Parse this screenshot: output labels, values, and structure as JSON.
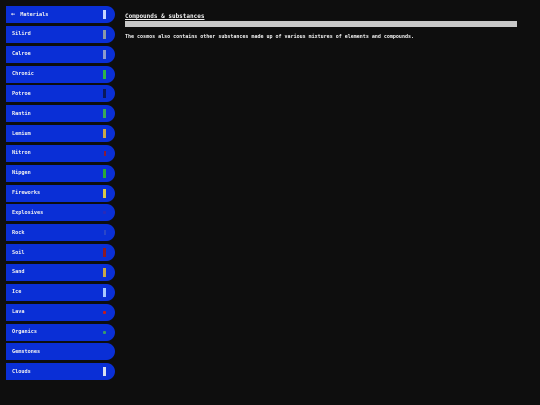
{
  "sidebar": {
    "back": {
      "label": "Materials",
      "swatch_color": "#c6d4ff"
    },
    "items": [
      {
        "label": "Silird",
        "swatch_color": "#8a9aa8",
        "swatch": "bar"
      },
      {
        "label": "Calroe",
        "swatch_color": "#8c9ccc",
        "swatch": "bar"
      },
      {
        "label": "Chronic",
        "swatch_color": "#2fb24a",
        "swatch": "bar"
      },
      {
        "label": "Potroe",
        "swatch_color": "#0a1a5a",
        "swatch": "bar"
      },
      {
        "label": "Rantin",
        "swatch_color": "#3aa85a",
        "swatch": "bar"
      },
      {
        "label": "Lemium",
        "swatch_color": "#c8a84a",
        "swatch": "bar"
      },
      {
        "label": "Nitron",
        "swatch_color": "#8a1a3a",
        "swatch": "small"
      },
      {
        "label": "Nipgen",
        "swatch_color": "#2aa83a",
        "swatch": "bar"
      },
      {
        "label": "Fireworks",
        "swatch_color": "#d8c84a",
        "swatch": "bar"
      },
      {
        "label": "Explosives",
        "swatch_color": "#2a2ab8",
        "swatch": "dot"
      },
      {
        "label": "Rock",
        "swatch_color": "#2a46c8",
        "swatch": "small"
      },
      {
        "label": "Soil",
        "swatch_color": "#8a1a2a",
        "swatch": "bar"
      },
      {
        "label": "Sand",
        "swatch_color": "#c8a84a",
        "swatch": "bar"
      },
      {
        "label": "Ice",
        "swatch_color": "#a8c8ff",
        "swatch": "bar"
      },
      {
        "label": "Lava",
        "swatch_color": "#c81a1a",
        "swatch": "dot"
      },
      {
        "label": "Organics",
        "swatch_color": "#3a9a6a",
        "swatch": "dot"
      },
      {
        "label": "Gemstones",
        "swatch_color": "#0a2fd6",
        "swatch": "none"
      },
      {
        "label": "Clouds",
        "swatch_color": "#d8e0f0",
        "swatch": "bar"
      }
    ]
  },
  "main": {
    "title": "Compounds & substances",
    "description": "The cosmos also contains other substances made up of various mixtures of elements and compounds."
  }
}
